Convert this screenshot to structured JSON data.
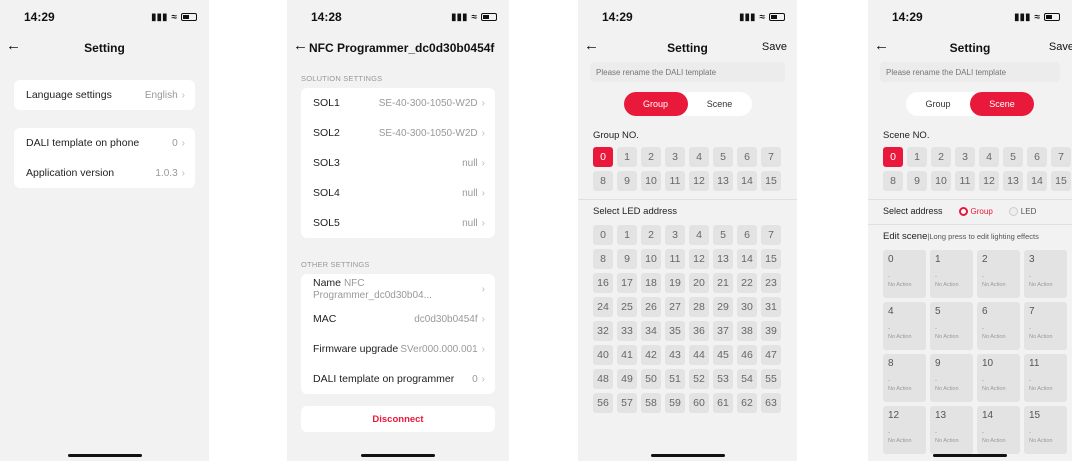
{
  "screen1": {
    "time": "14:29",
    "title": "Setting",
    "rows": [
      {
        "label": "Language settings",
        "value": "English"
      },
      {
        "label": "DALI template on phone",
        "value": "0"
      },
      {
        "label": "Application version",
        "value": "1.0.3"
      }
    ]
  },
  "screen2": {
    "time": "14:28",
    "title": "NFC Programmer_dc0d30b0454f",
    "solution_label": "SOLUTION SETTINGS",
    "solutions": [
      {
        "label": "SOL1",
        "value": "SE-40-300-1050-W2D"
      },
      {
        "label": "SOL2",
        "value": "SE-40-300-1050-W2D"
      },
      {
        "label": "SOL3",
        "value": "null"
      },
      {
        "label": "SOL4",
        "value": "null"
      },
      {
        "label": "SOL5",
        "value": "null"
      }
    ],
    "other_label": "OTHER SETTINGS",
    "others": [
      {
        "label": "Name",
        "value": "NFC Programmer_dc0d30b04..."
      },
      {
        "label": "MAC",
        "value": "dc0d30b0454f"
      },
      {
        "label": "Firmware upgrade",
        "value": "SVer000.000.001"
      },
      {
        "label": "DALI template on programmer",
        "value": "0"
      }
    ],
    "disconnect_label": "Disconnect"
  },
  "screen3": {
    "time": "14:29",
    "title": "Setting",
    "save_label": "Save",
    "rename_placeholder": "Please rename the DALI template",
    "tabs": [
      "Group",
      "Scene"
    ],
    "active_tab": "Group",
    "group_label": "Group NO.",
    "groups": [
      "0",
      "1",
      "2",
      "3",
      "4",
      "5",
      "6",
      "7",
      "8",
      "9",
      "10",
      "11",
      "12",
      "13",
      "14",
      "15"
    ],
    "selected_group": "0",
    "led_label": "Select LED address",
    "leds": [
      "0",
      "1",
      "2",
      "3",
      "4",
      "5",
      "6",
      "7",
      "8",
      "9",
      "10",
      "11",
      "12",
      "13",
      "14",
      "15",
      "16",
      "17",
      "18",
      "19",
      "20",
      "21",
      "22",
      "23",
      "24",
      "25",
      "26",
      "27",
      "28",
      "29",
      "30",
      "31",
      "32",
      "33",
      "34",
      "35",
      "36",
      "37",
      "38",
      "39",
      "40",
      "41",
      "42",
      "43",
      "44",
      "45",
      "46",
      "47",
      "48",
      "49",
      "50",
      "51",
      "52",
      "53",
      "54",
      "55",
      "56",
      "57",
      "58",
      "59",
      "60",
      "61",
      "62",
      "63"
    ]
  },
  "screen4": {
    "time": "14:29",
    "title": "Setting",
    "save_label": "Save",
    "rename_placeholder": "Please rename the DALI template",
    "tabs": [
      "Group",
      "Scene"
    ],
    "active_tab": "Scene",
    "scene_label": "Scene NO.",
    "scenes_no": [
      "0",
      "1",
      "2",
      "3",
      "4",
      "5",
      "6",
      "7",
      "8",
      "9",
      "10",
      "11",
      "12",
      "13",
      "14",
      "15"
    ],
    "selected_scene": "0",
    "address_label": "Select address",
    "address_options": [
      "Group",
      "LED"
    ],
    "address_selected": "Group",
    "edit_label": "Edit scene",
    "edit_hint": "|Long press to edit lighting effects",
    "scene_dash": "-",
    "scene_action": "No Action",
    "scene_cards": [
      "0",
      "1",
      "2",
      "3",
      "4",
      "5",
      "6",
      "7",
      "8",
      "9",
      "10",
      "11",
      "12",
      "13",
      "14",
      "15"
    ]
  },
  "colors": {
    "accent": "#e8193a"
  }
}
